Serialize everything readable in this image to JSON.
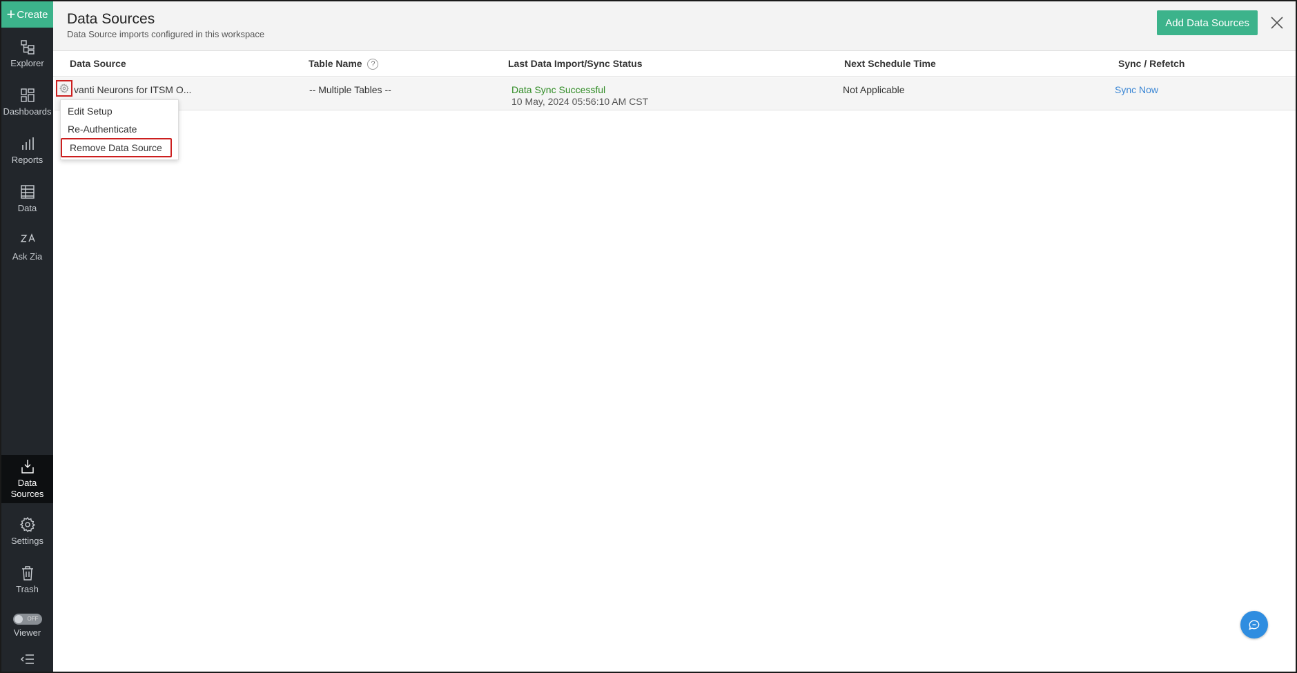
{
  "sidebar": {
    "create_label": "Create",
    "items": [
      {
        "label": "Explorer",
        "icon": "explorer-icon"
      },
      {
        "label": "Dashboards",
        "icon": "dashboards-icon"
      },
      {
        "label": "Reports",
        "icon": "reports-icon"
      },
      {
        "label": "Data",
        "icon": "data-icon"
      },
      {
        "label": "Ask Zia",
        "icon": "ask-zia-icon"
      }
    ],
    "active": {
      "label": "Data Sources",
      "icon": "data-sources-icon"
    },
    "bottom_items": [
      {
        "label": "Settings",
        "icon": "gear-icon"
      },
      {
        "label": "Trash",
        "icon": "trash-icon"
      }
    ],
    "viewer": {
      "label": "Viewer",
      "toggle_text": "OFF"
    }
  },
  "header": {
    "title": "Data Sources",
    "subtitle": "Data Source imports configured in this workspace",
    "add_button": "Add Data Sources"
  },
  "table": {
    "columns": [
      "Data Source",
      "Table Name",
      "Last Data Import/Sync Status",
      "Next Schedule Time",
      "Sync / Refetch"
    ],
    "help_glyph": "?",
    "rows": [
      {
        "data_source": "vanti Neurons for ITSM O...",
        "table_name": "-- Multiple Tables --",
        "status": "Data Sync Successful",
        "status_time": "10 May, 2024 05:56:10 AM CST",
        "next_schedule": "Not Applicable",
        "sync_action": "Sync Now"
      }
    ]
  },
  "menu": {
    "items": [
      "Edit Setup",
      "Re-Authenticate",
      "Remove Data Source"
    ]
  },
  "colors": {
    "accent": "#3cb38b",
    "sidebar_bg": "#22262b",
    "highlight_border": "#cc1f1f",
    "success": "#2e8b23",
    "link": "#3a86d4"
  }
}
